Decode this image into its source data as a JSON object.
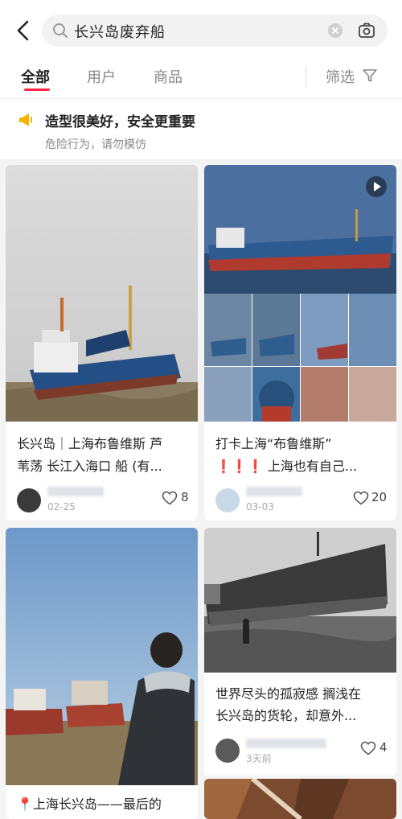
{
  "search": {
    "query": "长兴岛废弃船"
  },
  "tabs": [
    {
      "label": "全部",
      "active": true
    },
    {
      "label": "用户",
      "active": false
    },
    {
      "label": "商品",
      "active": false
    }
  ],
  "filter_label": "筛选",
  "notice": {
    "title": "造型很美好，安全更重要",
    "subtitle": "危险行为，请勿模仿"
  },
  "cards": [
    {
      "title_line1": "长兴岛｜上海布鲁维斯 芦",
      "title_line2": "苇荡 长江入海口 船 (有...",
      "date": "02-25",
      "likes": "8"
    },
    {
      "title_line1": "打卡上海“布鲁维斯”",
      "title_line2": "❗❗❗ 上海也有自己...",
      "date": "03-03",
      "likes": "20",
      "has_video": true
    },
    {
      "title_line1": "📍上海长兴岛——最后的",
      "title_line2": ""
    },
    {
      "title_line1": "世界尽头的孤寂感 搁浅在",
      "title_line2": "长兴岛的货轮，却意外...",
      "date": "3天前",
      "likes": "4"
    }
  ],
  "colors": {
    "accent": "#ff2442",
    "notice_icon": "#f5b400"
  }
}
